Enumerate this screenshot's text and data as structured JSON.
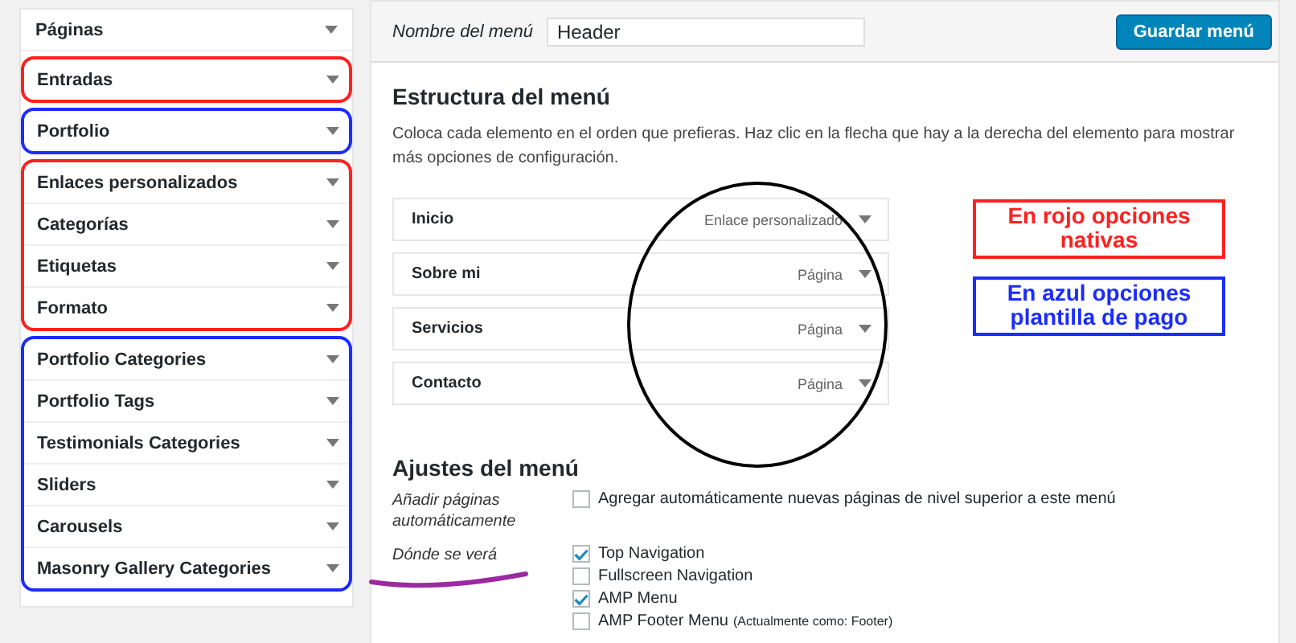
{
  "sidebar": {
    "groups": [
      {
        "items": [
          {
            "label": "Páginas"
          }
        ]
      },
      {
        "color": "#ff2020",
        "items": [
          {
            "label": "Entradas"
          }
        ]
      },
      {
        "color": "#1a2cff",
        "items": [
          {
            "label": "Portfolio"
          }
        ]
      },
      {
        "color": "#ff2020",
        "items": [
          {
            "label": "Enlaces personalizados"
          },
          {
            "label": "Categorías"
          },
          {
            "label": "Etiquetas"
          },
          {
            "label": "Formato"
          }
        ]
      },
      {
        "color": "#1a2cff",
        "items": [
          {
            "label": "Portfolio Categories"
          },
          {
            "label": "Portfolio Tags"
          },
          {
            "label": "Testimonials Categories"
          },
          {
            "label": "Sliders"
          },
          {
            "label": "Carousels"
          },
          {
            "label": "Masonry Gallery Categories"
          }
        ]
      }
    ]
  },
  "header": {
    "name_label": "Nombre del menú",
    "name_value": "Header",
    "save_button": "Guardar menú"
  },
  "structure": {
    "title": "Estructura del menú",
    "description": "Coloca cada elemento en el orden que prefieras. Haz clic en la flecha que hay a la derecha del elemento para mostrar más opciones de configuración.",
    "items": [
      {
        "title": "Inicio",
        "type": "Enlace personalizado"
      },
      {
        "title": "Sobre mi",
        "type": "Página"
      },
      {
        "title": "Servicios",
        "type": "Página"
      },
      {
        "title": "Contacto",
        "type": "Página"
      }
    ]
  },
  "annotations": [
    {
      "text": "En rojo opciones nativas",
      "color": "#ff2020"
    },
    {
      "text": "En azul opciones plantilla de pago",
      "color": "#1a2cff"
    }
  ],
  "settings": {
    "title": "Ajustes del menú",
    "rows": [
      {
        "label": "Añadir páginas automáticamente",
        "underlined": false,
        "options": [
          {
            "label": "Agregar automáticamente nuevas páginas de nivel superior a este menú",
            "checked": false
          }
        ]
      },
      {
        "label": "Dónde se verá",
        "underlined": true,
        "options": [
          {
            "label": "Top Navigation",
            "checked": true
          },
          {
            "label": "Fullscreen Navigation",
            "checked": false
          },
          {
            "label": "AMP Menu",
            "checked": true
          },
          {
            "label": "AMP Footer Menu",
            "note": "(Actualmente como: Footer)",
            "checked": false
          }
        ]
      }
    ]
  }
}
